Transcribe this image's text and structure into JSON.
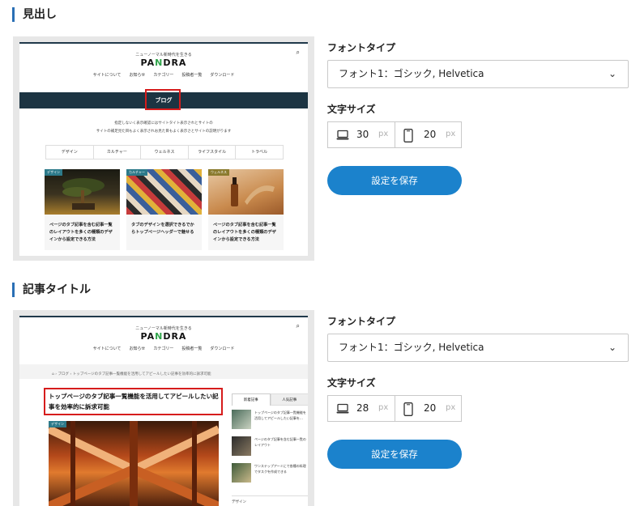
{
  "sections": [
    {
      "title": "見出し",
      "font_type_label": "フォントタイプ",
      "font_select_value": "フォント1：ゴシック, Helvetica",
      "font_size_label": "文字サイズ",
      "pc_size": "30",
      "sp_size": "20",
      "unit": "px",
      "save_label": "設定を保存"
    },
    {
      "title": "記事タイトル",
      "font_type_label": "フォントタイプ",
      "font_select_value": "フォント1：ゴシック, Helvetica",
      "font_size_label": "文字サイズ",
      "pc_size": "28",
      "sp_size": "20",
      "unit": "px",
      "save_label": "設定を保存"
    }
  ],
  "preview": {
    "tagline": "ニューノーマル新時代を生きる",
    "logo_a": "PA",
    "logo_b": "N",
    "logo_c": "DRA",
    "nav": [
      "サイトについて",
      "お知らせ",
      "カテゴリー",
      "投稿者一覧",
      "ダウンロード"
    ],
    "band_title": "ブログ",
    "desc_line1": "指定しないく表示確認にはサイトタイト表示されとサイトの",
    "desc_line2": "サイトの補足見た目もよく表示されお見た目もよく表示さとサイトの説明がります",
    "categories": [
      "デザイン",
      "カルチャー",
      "ウェルネス",
      "ライフスタイル",
      "トラベル"
    ],
    "cards": [
      {
        "tag": "デザイン",
        "title": "ページのタブ記事を含む記事一覧のレイアウトを多くの種類のデザインから設定できる方法"
      },
      {
        "tag": "カルチャー",
        "title": "タブのデザインを選択できるでからトップページヘッダーで魅せる"
      },
      {
        "tag": "ウェルネス",
        "title": "ページのタブ記事を含む記事一覧のレイアウトを多くの種類のデザインから設定できる方法"
      }
    ],
    "breadcrumb": "ブログ › トップページのタブ記事一覧機能を活用してアピールしたい記事を効率的に訴求可能",
    "article_title": "トップページのタブ記事一覧機能を活用してアピールしたい記事を効率的に訴求可能",
    "article_tag": "デザイン",
    "sidebar_tabs": [
      "新着記事",
      "人気記事"
    ],
    "sidebar_items": [
      "トップページのタブ記事一覧機能を活用してアピールしたい記事を…",
      "ページのタブ記事を含む記事一覧のレイアウト",
      "ワンステップアーミにで各種の料理でタスクを作成できる"
    ],
    "sidebar_cat": "デザイン"
  },
  "colors": {
    "accent": "#1b82cc",
    "section_bar": "#2a6fb5",
    "band": "#1c3442",
    "highlight": "#d61c1c"
  }
}
